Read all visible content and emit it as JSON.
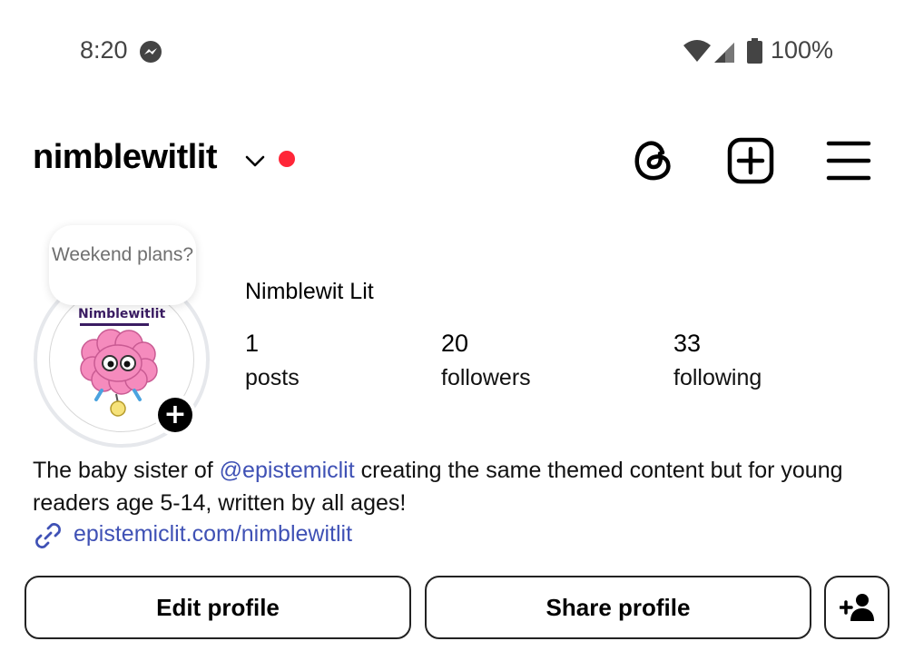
{
  "status_bar": {
    "time": "8:20",
    "battery_percent": "100%",
    "notification_icon": "messenger-icon",
    "icons": [
      "wifi-icon",
      "cell-signal-icon",
      "battery-icon"
    ]
  },
  "header": {
    "username": "nimblewitlit",
    "has_unread_dot": true,
    "icons": [
      "threads-icon",
      "create-post-icon",
      "menu-icon"
    ]
  },
  "profile": {
    "note": "Weekend plans?",
    "avatar_text": "Nimblewitlit",
    "display_name": "Nimblewit Lit",
    "stats": {
      "posts": {
        "value": "1",
        "label": "posts"
      },
      "followers": {
        "value": "20",
        "label": "followers"
      },
      "following": {
        "value": "33",
        "label": "following"
      }
    },
    "bio": {
      "prefix": "The baby sister of ",
      "mention": "@epistemiclit",
      "suffix": " creating the same themed content but for young readers age 5-14, written by all ages!"
    },
    "link": "epistemiclit.com/nimblewitlit"
  },
  "actions": {
    "edit_profile": "Edit profile",
    "share_profile": "Share profile",
    "discover_people_icon": "add-person-icon"
  },
  "colors": {
    "accent_link": "#3f51b5",
    "unread_dot": "#ff2638",
    "avatar_brain": "#f58bbd"
  }
}
